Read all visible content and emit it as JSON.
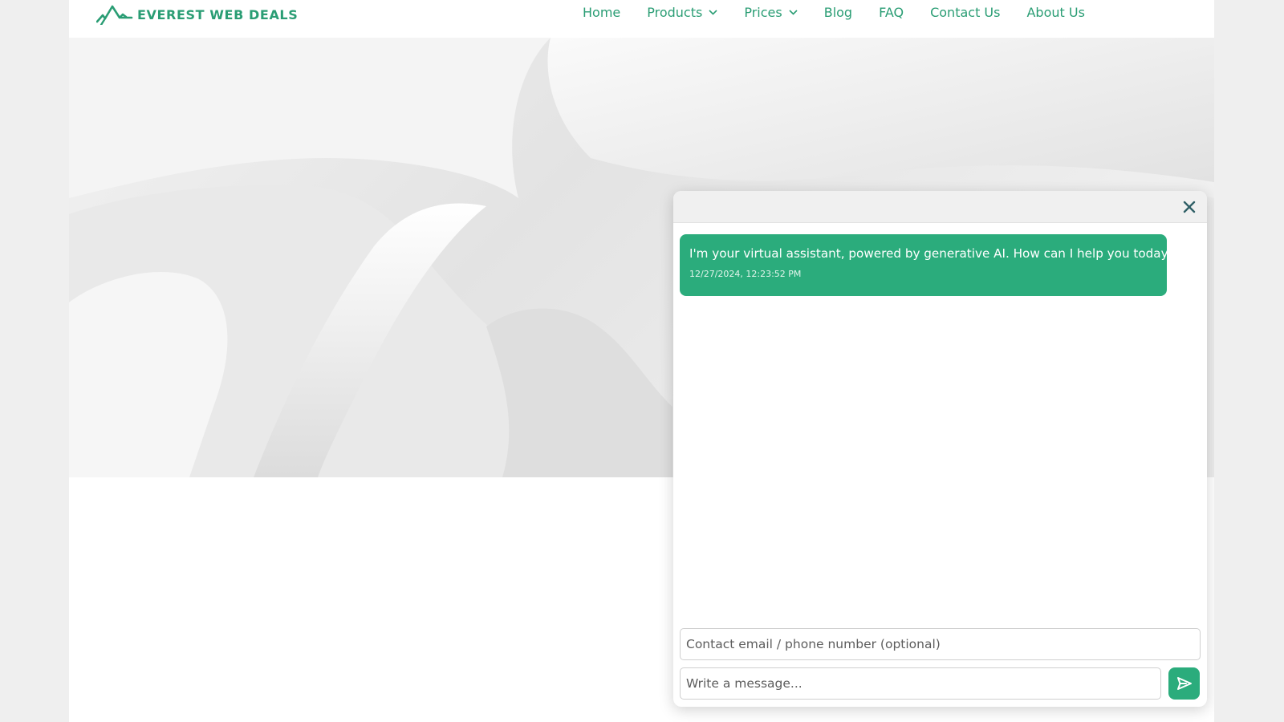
{
  "colors": {
    "brand": "#2a9d74",
    "accent": "#2bac7c",
    "page_bg": "#efefef"
  },
  "header": {
    "logo_text": "EVEREST WEB DEALS",
    "logo_icon": "mountain-peaks-logo",
    "nav": [
      {
        "label": "Home",
        "dropdown": false
      },
      {
        "label": "Products",
        "dropdown": true
      },
      {
        "label": "Prices",
        "dropdown": true
      },
      {
        "label": "Blog",
        "dropdown": false
      },
      {
        "label": "FAQ",
        "dropdown": false
      },
      {
        "label": "Contact Us",
        "dropdown": false
      },
      {
        "label": "About Us",
        "dropdown": false
      }
    ]
  },
  "chat": {
    "close_icon": "close-icon",
    "messages": [
      {
        "text": "I'm your virtual assistant, powered by generative AI. How can I help you today?",
        "time": "12/27/2024, 12:23:52 PM"
      }
    ],
    "contact_placeholder": "Contact email / phone number (optional)",
    "message_placeholder": "Write a message...",
    "send_icon": "send-icon"
  }
}
